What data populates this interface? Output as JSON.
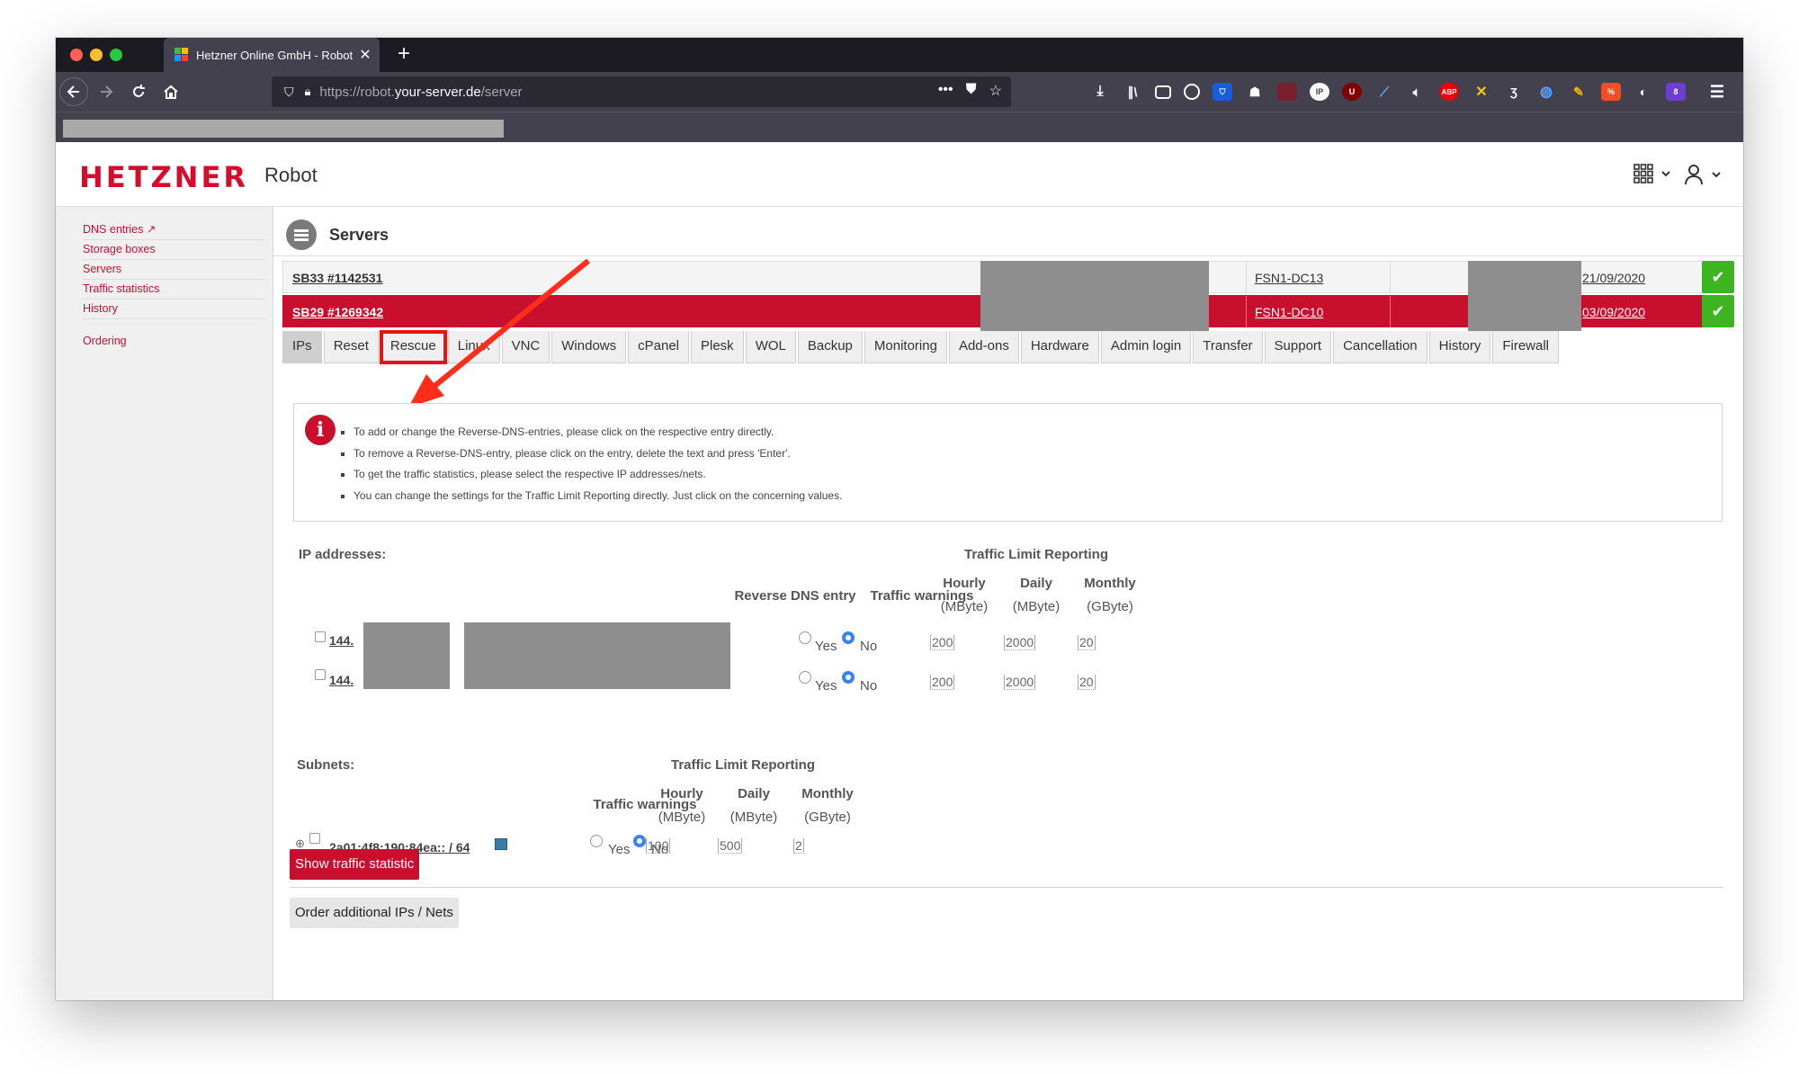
{
  "browser": {
    "tab_title": "Hetzner Online GmbH - Robot",
    "url_prefix": "https://robot.",
    "url_host": "your-server.de",
    "url_path": "/server"
  },
  "header": {
    "logo": "HETZNER",
    "product": "Robot"
  },
  "sidebar": {
    "items": [
      {
        "label": "DNS entries"
      },
      {
        "label": "Storage boxes"
      },
      {
        "label": "Servers"
      },
      {
        "label": "Traffic statistics"
      },
      {
        "label": "History"
      }
    ],
    "ordering": "Ordering"
  },
  "servers": {
    "title": "Servers",
    "rows": [
      {
        "name": "SB33 #1142531",
        "datacenter": "FSN1-DC13",
        "date": "21/09/2020"
      },
      {
        "name": "SB29 #1269342",
        "datacenter": "FSN1-DC10",
        "date": "03/09/2020"
      }
    ]
  },
  "tabs": [
    "IPs",
    "Reset",
    "Rescue",
    "Linux",
    "VNC",
    "Windows",
    "cPanel",
    "Plesk",
    "WOL",
    "Backup",
    "Monitoring",
    "Add-ons",
    "Hardware",
    "Admin login",
    "Transfer",
    "Support",
    "Cancellation",
    "History",
    "Firewall"
  ],
  "info": {
    "lines": [
      "To add or change the Reverse-DNS-entries, please click on the respective entry directly.",
      "To remove a Reverse-DNS-entry, please click on the entry, delete the text and press 'Enter'.",
      "To get the traffic statistics, please select the respective IP addresses/nets.",
      "You can change the settings for the Traffic Limit Reporting directly. Just click on the concerning values."
    ]
  },
  "ips": {
    "label": "IP addresses:",
    "traffic_limit_reporting": "Traffic Limit Reporting",
    "reverse_dns": "Reverse DNS entry",
    "traffic_warnings": "Traffic warnings",
    "hourly": "Hourly",
    "daily": "Daily",
    "monthly": "Monthly",
    "mbyte": "(MByte)",
    "gbyte": "(GByte)",
    "yes": "Yes",
    "no": "No",
    "rows": [
      {
        "ip": "144.",
        "hourly": "200",
        "daily": "2000",
        "monthly": "20"
      },
      {
        "ip": "144.",
        "hourly": "200",
        "daily": "2000",
        "monthly": "20"
      }
    ]
  },
  "subnets": {
    "label": "Subnets:",
    "traffic_limit_reporting": "Traffic Limit Reporting",
    "traffic_warnings": "Traffic warnings",
    "rows": [
      {
        "subnet": "2a01:4f8:190:84ea:: / 64",
        "hourly": "100",
        "daily": "500",
        "monthly": "2"
      }
    ]
  },
  "buttons": {
    "show_traffic": "Show traffic statistic",
    "order_ips": "Order additional IPs / Nets"
  }
}
